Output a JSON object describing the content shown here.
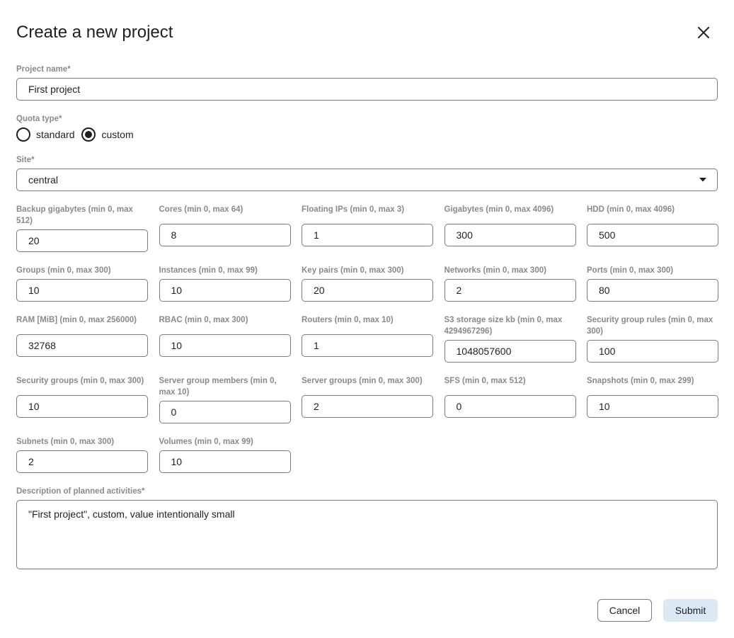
{
  "dialog": {
    "title": "Create a new project",
    "close_icon": "close-icon"
  },
  "project_name": {
    "label": "Project name*",
    "value": "First project"
  },
  "quota_type": {
    "label": "Quota type*",
    "options": [
      {
        "label": "standard",
        "selected": false
      },
      {
        "label": "custom",
        "selected": true
      }
    ]
  },
  "site": {
    "label": "Site*",
    "value": "central",
    "icon": "chevron-down-icon"
  },
  "quotas": [
    {
      "label": "Backup gigabytes (min 0, max 512)",
      "value": "20"
    },
    {
      "label": "Cores (min 0, max 64)",
      "value": "8"
    },
    {
      "label": "Floating IPs (min 0, max 3)",
      "value": "1"
    },
    {
      "label": "Gigabytes (min 0, max 4096)",
      "value": "300"
    },
    {
      "label": "HDD (min 0, max 4096)",
      "value": "500"
    },
    {
      "label": "Groups (min 0, max 300)",
      "value": "10"
    },
    {
      "label": "Instances (min 0, max 99)",
      "value": "10"
    },
    {
      "label": "Key pairs (min 0, max 300)",
      "value": "20"
    },
    {
      "label": "Networks (min 0, max 300)",
      "value": "2"
    },
    {
      "label": "Ports (min 0, max 300)",
      "value": "80"
    },
    {
      "label": "RAM [MiB] (min 0, max 256000)",
      "value": "32768"
    },
    {
      "label": "RBAC (min 0, max 300)",
      "value": "10"
    },
    {
      "label": "Routers (min 0, max 10)",
      "value": "1"
    },
    {
      "label": "S3 storage size kb (min 0, max 4294967296)",
      "value": "1048057600"
    },
    {
      "label": "Security group rules (min 0, max 300)",
      "value": "100"
    },
    {
      "label": "Security groups (min 0, max 300)",
      "value": "10"
    },
    {
      "label": "Server group members (min 0, max 10)",
      "value": "0"
    },
    {
      "label": "Server groups (min 0, max 300)",
      "value": "2"
    },
    {
      "label": "SFS (min 0, max 512)",
      "value": "0"
    },
    {
      "label": "Snapshots (min 0, max 299)",
      "value": "10"
    },
    {
      "label": "Subnets (min 0, max 300)",
      "value": "2"
    },
    {
      "label": "Volumes (min 0, max 99)",
      "value": "10"
    }
  ],
  "description": {
    "label": "Description of planned activities*",
    "value": "\"First project\", custom, value intentionally small"
  },
  "actions": {
    "cancel_label": "Cancel",
    "submit_label": "Submit"
  }
}
